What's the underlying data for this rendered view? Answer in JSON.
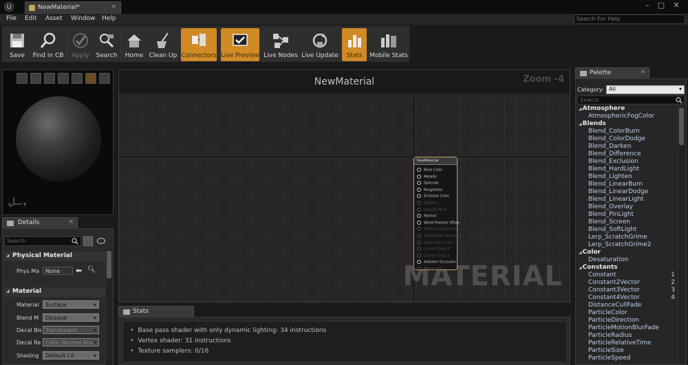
{
  "window": {
    "tab_title": "NewMaterial*",
    "minimize": "–",
    "maximize": "□",
    "close": "✕",
    "tab_close": "×"
  },
  "menu": [
    "File",
    "Edit",
    "Asset",
    "Window",
    "Help"
  ],
  "help_search": {
    "placeholder": "Search For Help"
  },
  "toolbar": [
    {
      "label": "Save",
      "icon": "save-icon",
      "state": "normal"
    },
    {
      "label": "Find in CB",
      "icon": "find-in-content-browser-icon",
      "state": "normal"
    },
    {
      "label": "Apply",
      "icon": "apply-icon",
      "state": "disabled"
    },
    {
      "label": "Search",
      "icon": "search-icon",
      "state": "normal"
    },
    {
      "label": "Home",
      "icon": "home-icon",
      "state": "normal"
    },
    {
      "label": "Clean Up",
      "icon": "clean-up-icon",
      "state": "normal"
    },
    {
      "label": "Connectors",
      "icon": "connectors-icon",
      "state": "active"
    },
    {
      "label": "Live Preview",
      "icon": "live-preview-icon",
      "state": "active"
    },
    {
      "label": "Live Nodes",
      "icon": "live-nodes-icon",
      "state": "normal"
    },
    {
      "label": "Live Update",
      "icon": "live-update-icon",
      "state": "normal"
    },
    {
      "label": "Stats",
      "icon": "stats-icon",
      "state": "active"
    },
    {
      "label": "Mobile Stats",
      "icon": "mobile-stats-icon",
      "state": "normal"
    }
  ],
  "viewport": {
    "axis_x": "x",
    "axis_y": "Y"
  },
  "details": {
    "tab_label": "Details",
    "search_placeholder": "Search",
    "physical_material": {
      "header": "Physical Material",
      "label": "Phys Ma",
      "value": "None"
    },
    "material": {
      "header": "Material",
      "rows": [
        {
          "label": "Material",
          "value": "Surface",
          "disabled": false
        },
        {
          "label": "Blend M",
          "value": "Opaque",
          "disabled": false
        },
        {
          "label": "Decal Ble",
          "value": "Translucent",
          "disabled": true
        },
        {
          "label": "Decal Re",
          "value": "Color Normal Rou",
          "disabled": true
        },
        {
          "label": "Shading",
          "value": "Default Lit",
          "disabled": false
        }
      ]
    }
  },
  "graph": {
    "title": "NewMaterial",
    "zoom": "Zoom -4",
    "watermark": "MATERIAL",
    "node": {
      "title": "NewMaterial",
      "pins": [
        {
          "label": "Base Color",
          "dim": false
        },
        {
          "label": "Metallic",
          "dim": false
        },
        {
          "label": "Specular",
          "dim": false
        },
        {
          "label": "Roughness",
          "dim": false
        },
        {
          "label": "Emissive Color",
          "dim": false
        },
        {
          "label": "Opacity",
          "dim": true
        },
        {
          "label": "Opacity Mask",
          "dim": true
        },
        {
          "label": "Normal",
          "dim": false
        },
        {
          "label": "World Position Offset",
          "dim": false
        },
        {
          "label": "World Displacement",
          "dim": true
        },
        {
          "label": "Tessellation Multiplier",
          "dim": true
        },
        {
          "label": "Subsurface Color",
          "dim": true
        },
        {
          "label": "Custom Data 0",
          "dim": true
        },
        {
          "label": "Custom Data 1",
          "dim": true
        },
        {
          "label": "Ambient Occlusion",
          "dim": false
        },
        {
          "label": "Refraction",
          "dim": true
        }
      ]
    }
  },
  "stats": {
    "tab_label": "Stats",
    "lines": [
      "Base pass shader with only dynamic lighting: 34 instructions",
      "Vertex shader: 31 instructions",
      "Texture samplers: 0/16"
    ]
  },
  "palette": {
    "tab_label": "Palette",
    "category_label": "Category:",
    "category_value": "All",
    "search_placeholder": "Search",
    "groups": [
      {
        "name": "Atmosphere",
        "items": [
          {
            "label": "AtmosphericFogColor",
            "num": ""
          }
        ]
      },
      {
        "name": "Blends",
        "items": [
          {
            "label": "Blend_ColorBurn",
            "num": ""
          },
          {
            "label": "Blend_ColorDodge",
            "num": ""
          },
          {
            "label": "Blend_Darken",
            "num": ""
          },
          {
            "label": "Blend_Difference",
            "num": ""
          },
          {
            "label": "Blend_Exclusion",
            "num": ""
          },
          {
            "label": "Blend_HardLight",
            "num": ""
          },
          {
            "label": "Blend_Lighten",
            "num": ""
          },
          {
            "label": "Blend_LinearBurn",
            "num": ""
          },
          {
            "label": "Blend_LinearDodge",
            "num": ""
          },
          {
            "label": "Blend_LinearLight",
            "num": ""
          },
          {
            "label": "Blend_Overlay",
            "num": ""
          },
          {
            "label": "Blend_PinLight",
            "num": ""
          },
          {
            "label": "Blend_Screen",
            "num": ""
          },
          {
            "label": "Blend_SoftLight",
            "num": ""
          },
          {
            "label": "Lerp_ScratchGrime",
            "num": ""
          },
          {
            "label": "Lerp_ScratchGrime2",
            "num": ""
          }
        ]
      },
      {
        "name": "Color",
        "items": [
          {
            "label": "Desaturation",
            "num": ""
          }
        ]
      },
      {
        "name": "Constants",
        "items": [
          {
            "label": "Constant",
            "num": "1"
          },
          {
            "label": "Constant2Vector",
            "num": "2"
          },
          {
            "label": "Constant3Vector",
            "num": "3"
          },
          {
            "label": "Constant4Vector",
            "num": "4"
          },
          {
            "label": "DistanceCullFade",
            "num": ""
          },
          {
            "label": "ParticleColor",
            "num": ""
          },
          {
            "label": "ParticleDirection",
            "num": ""
          },
          {
            "label": "ParticleMotionBlurFade",
            "num": ""
          },
          {
            "label": "ParticleRadius",
            "num": ""
          },
          {
            "label": "ParticleRelativeTime",
            "num": ""
          },
          {
            "label": "ParticleSize",
            "num": ""
          },
          {
            "label": "ParticleSpeed",
            "num": ""
          }
        ]
      }
    ]
  },
  "colors": {
    "accent_active": "#d08a26",
    "node_border": "#c9a257",
    "palette_item": "#bdd0ec"
  }
}
